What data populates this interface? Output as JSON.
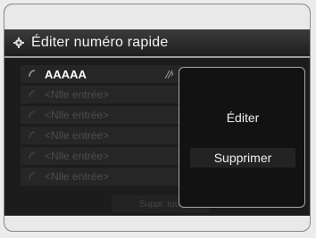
{
  "title": "Éditer numéro rapide",
  "list": [
    {
      "label": "AAAAA"
    },
    {
      "label": "<Nlle entrée>"
    },
    {
      "label": "<Nlle entrée>"
    },
    {
      "label": "<Nlle entrée>"
    },
    {
      "label": "<Nlle entrée>"
    },
    {
      "label": "<Nlle entrée>"
    }
  ],
  "delete_all_label": "Suppr. tout",
  "popup": {
    "edit_label": "Éditer",
    "delete_label": "Supprimer"
  },
  "icons": {
    "title": "gear-icon",
    "row": "phone-icon",
    "voice": "voice-tag-icon"
  },
  "colors": {
    "screen_bg": "#1c1c1c",
    "popup_border": "#a8a8a8",
    "text": "#f0f0f0"
  }
}
